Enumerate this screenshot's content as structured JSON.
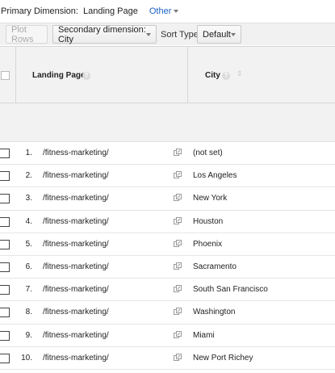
{
  "primary_dimension": {
    "label": "Primary Dimension:",
    "value": "Landing Page",
    "other": "Other"
  },
  "toolbar": {
    "plot_rows": "Plot Rows",
    "secondary_dimension": "Secondary dimension: City",
    "sort_type_label": "Sort Type:",
    "sort_type_value": "Default"
  },
  "table": {
    "columns": [
      "Landing Page",
      "City"
    ],
    "rows": [
      {
        "num": "1.",
        "page": "/fitness-marketing/",
        "city": "(not set)"
      },
      {
        "num": "2.",
        "page": "/fitness-marketing/",
        "city": "Los Angeles"
      },
      {
        "num": "3.",
        "page": "/fitness-marketing/",
        "city": "New York"
      },
      {
        "num": "4.",
        "page": "/fitness-marketing/",
        "city": "Houston"
      },
      {
        "num": "5.",
        "page": "/fitness-marketing/",
        "city": "Phoenix"
      },
      {
        "num": "6.",
        "page": "/fitness-marketing/",
        "city": "Sacramento"
      },
      {
        "num": "7.",
        "page": "/fitness-marketing/",
        "city": "South San Francisco"
      },
      {
        "num": "8.",
        "page": "/fitness-marketing/",
        "city": "Washington"
      },
      {
        "num": "9.",
        "page": "/fitness-marketing/",
        "city": "Miami"
      },
      {
        "num": "10.",
        "page": "/fitness-marketing/",
        "city": "New Port Richey"
      }
    ]
  },
  "icons": {
    "help": "help-icon",
    "sort": "sort-arrows-icon",
    "open_link": "open-in-new-window-icon"
  },
  "colors": {
    "link_blue": "#1a62c5",
    "header_bg": "#f2f2f2",
    "toolbar_bg": "#f1f1f1"
  }
}
